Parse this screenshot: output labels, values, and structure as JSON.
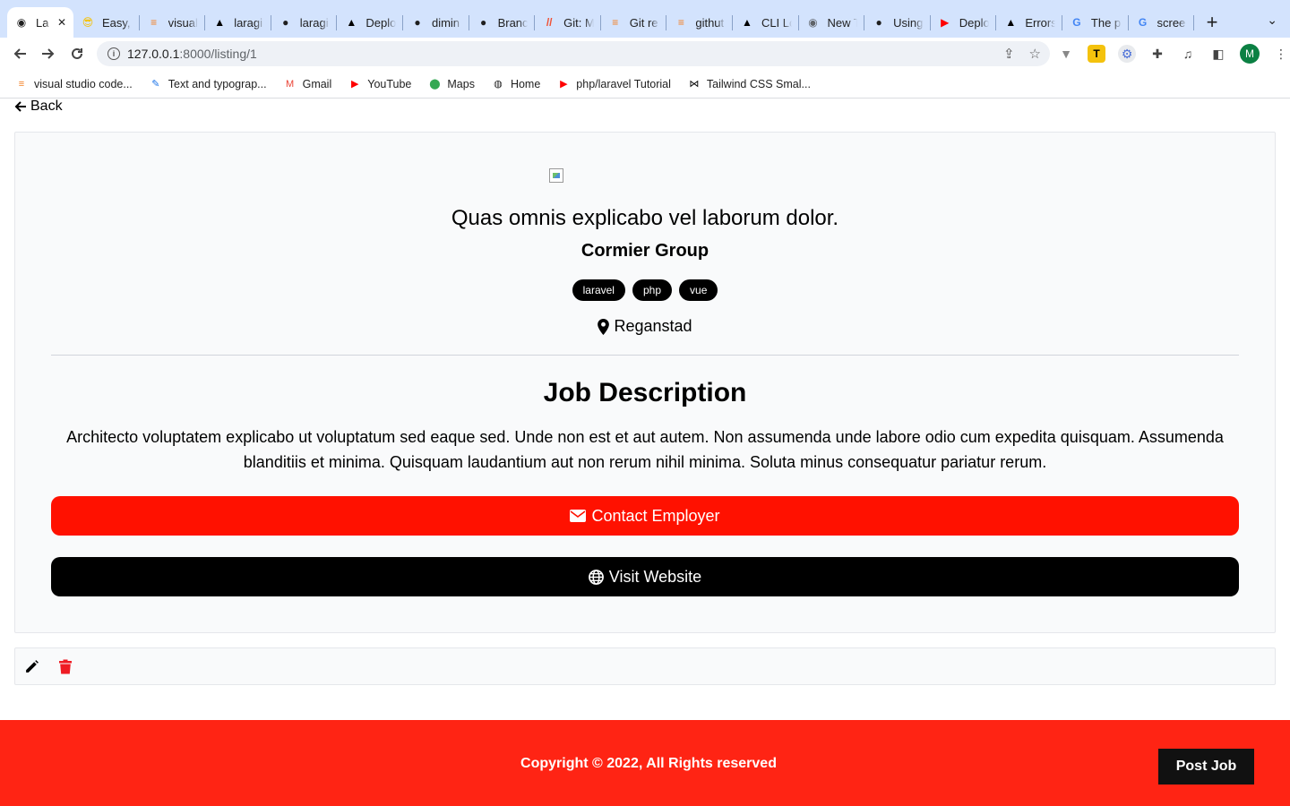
{
  "browser": {
    "tabs": [
      {
        "title": "La",
        "icon": "laravel-icon",
        "color": "#1f1f1f",
        "glyph": "",
        "active": true
      },
      {
        "title": "Easy,",
        "icon": "sunglasses-emoji-icon",
        "color": "#f4c20d",
        "glyph": "😎",
        "active": false
      },
      {
        "title": "visual",
        "icon": "stackoverflow-icon",
        "color": "#f48024",
        "glyph": "≡",
        "active": false
      },
      {
        "title": "laragi",
        "icon": "vercel-icon",
        "color": "#000000",
        "glyph": "▲",
        "active": false
      },
      {
        "title": "laragi",
        "icon": "github-icon",
        "color": "#1f1f1f",
        "glyph": "●",
        "active": false
      },
      {
        "title": "Deplo",
        "icon": "vercel-icon",
        "color": "#000000",
        "glyph": "▲",
        "active": false
      },
      {
        "title": "dimin",
        "icon": "github-icon",
        "color": "#1f1f1f",
        "glyph": "●",
        "active": false
      },
      {
        "title": "Branc",
        "icon": "github-icon",
        "color": "#1f1f1f",
        "glyph": "●",
        "active": false
      },
      {
        "title": "Git: M",
        "icon": "git-icon",
        "color": "#f05033",
        "glyph": "//",
        "active": false
      },
      {
        "title": "Git re",
        "icon": "stackoverflow-icon",
        "color": "#f48024",
        "glyph": "≡",
        "active": false
      },
      {
        "title": "githut",
        "icon": "stackoverflow-icon",
        "color": "#f48024",
        "glyph": "≡",
        "active": false
      },
      {
        "title": "CLI Lo",
        "icon": "vercel-icon",
        "color": "#000000",
        "glyph": "▲",
        "active": false
      },
      {
        "title": "New T",
        "icon": "chrome-icon",
        "color": "#5f6368",
        "glyph": "◉",
        "active": false
      },
      {
        "title": "Using",
        "icon": "github-icon",
        "color": "#1f1f1f",
        "glyph": "●",
        "active": false
      },
      {
        "title": "Deplo",
        "icon": "youtube-icon",
        "color": "#ff0000",
        "glyph": "▶",
        "active": false
      },
      {
        "title": "Errors",
        "icon": "vercel-icon",
        "color": "#000000",
        "glyph": "▲",
        "active": false
      },
      {
        "title": "The p",
        "icon": "google-icon",
        "color": "#4285f4",
        "glyph": "G",
        "active": false
      },
      {
        "title": "scree",
        "icon": "google-icon",
        "color": "#4285f4",
        "glyph": "G",
        "active": false
      }
    ],
    "url_host": "127.0.0.1",
    "url_path": ":8000/listing/1",
    "bookmarks": [
      {
        "label": "visual studio code...",
        "icon": "stackoverflow-icon",
        "glyph": "≡",
        "color": "#f48024"
      },
      {
        "label": "Text and typograp...",
        "icon": "feather-icon",
        "glyph": "✎",
        "color": "#1a73e8"
      },
      {
        "label": "Gmail",
        "icon": "gmail-icon",
        "glyph": "M",
        "color": "#ea4335"
      },
      {
        "label": "YouTube",
        "icon": "youtube-icon",
        "glyph": "▶",
        "color": "#ff0000"
      },
      {
        "label": "Maps",
        "icon": "maps-pin-icon",
        "glyph": "⬤",
        "color": "#34a853"
      },
      {
        "label": "Home",
        "icon": "globe-icon",
        "glyph": "◍",
        "color": "#1f1f1f"
      },
      {
        "label": "php/laravel Tutorial",
        "icon": "youtube-icon",
        "glyph": "▶",
        "color": "#ff0000"
      },
      {
        "label": "Tailwind CSS Smal...",
        "icon": "bowtie-icon",
        "glyph": "⋈",
        "color": "#000000"
      }
    ]
  },
  "page": {
    "back_label": "Back",
    "title": "Quas omnis explicabo vel laborum dolor.",
    "company": "Cormier Group",
    "tags": [
      "laravel",
      "php",
      "vue"
    ],
    "location": "Reganstad",
    "description_heading": "Job Description",
    "description": "Architecto voluptatem explicabo ut voluptatum sed eaque sed. Unde non est et aut autem. Non assumenda unde labore odio cum expedita quisquam. Assumenda blanditiis et minima. Quisquam laudantium aut non rerum nihil minima. Soluta minus consequatur pariatur rerum.",
    "contact_label": "Contact Employer",
    "website_label": "Visit Website"
  },
  "footer": {
    "copyright": "Copyright © 2022, All Rights reserved",
    "post_job_label": "Post Job"
  },
  "colors": {
    "contact_button": "#ff1100",
    "footer_bg": "#ff2414",
    "delete_icon": "#ef1c24"
  }
}
